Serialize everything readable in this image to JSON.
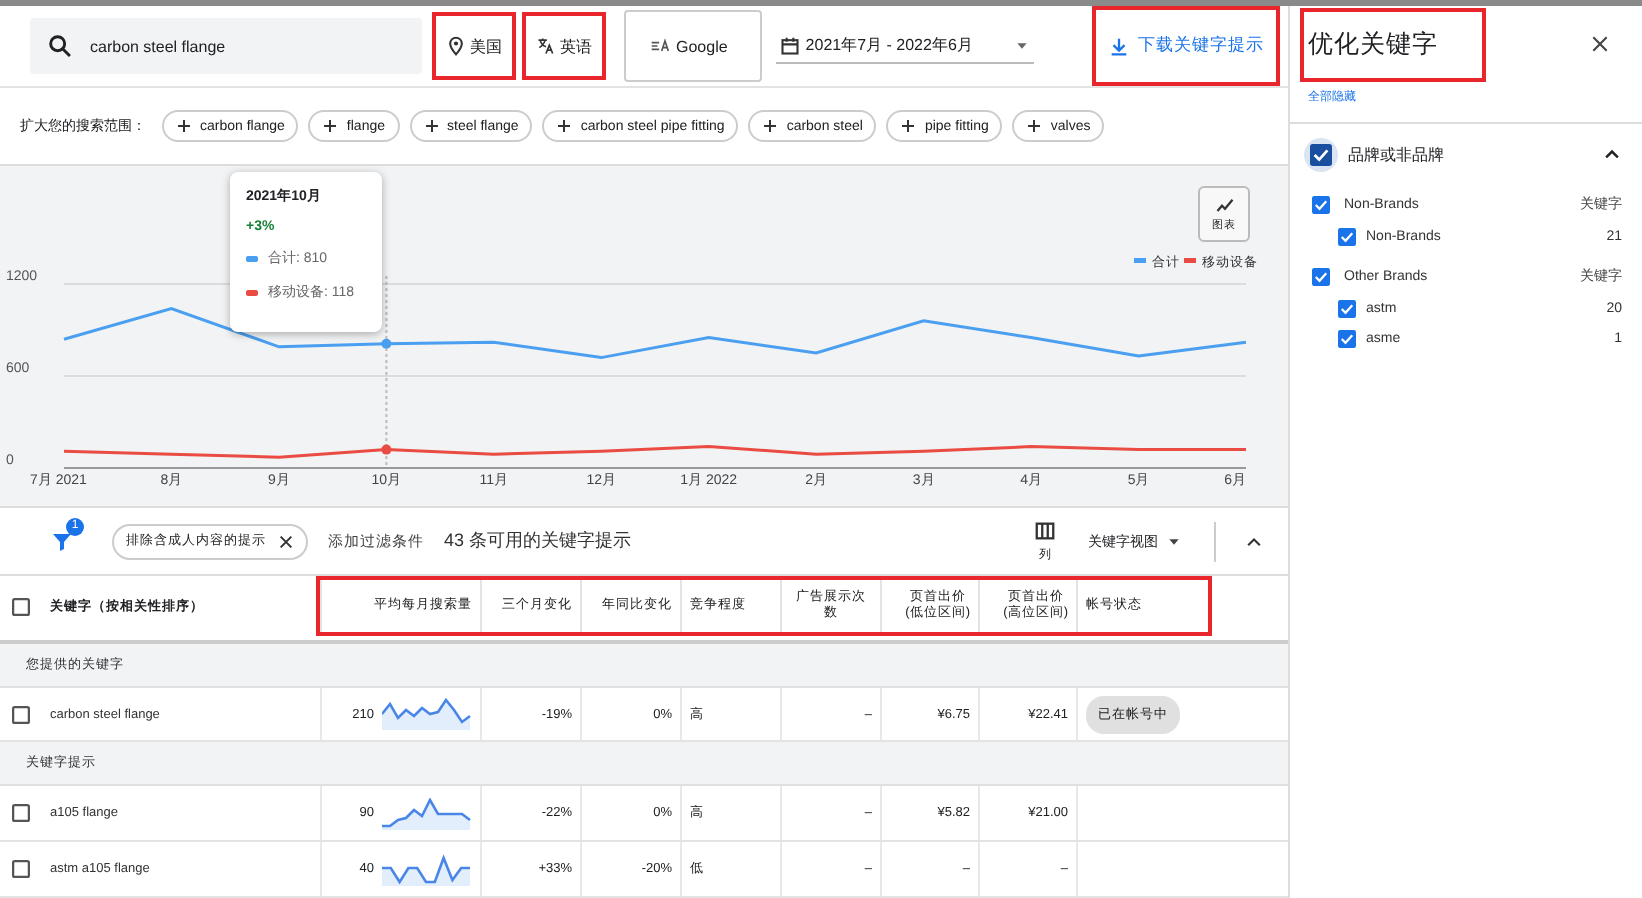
{
  "search": {
    "value": "carbon steel flange"
  },
  "location": {
    "label": "美国",
    "highlighted": true
  },
  "language": {
    "label": "英语",
    "highlighted": true
  },
  "network": {
    "label": "Google"
  },
  "date_range": {
    "label": "2021年7月 - 2022年6月"
  },
  "download_button": {
    "label": "下载关键字提示",
    "highlighted": true
  },
  "broaden": {
    "label": "扩大您的搜索范围：",
    "chips": [
      "carbon flange",
      "flange",
      "steel flange",
      "carbon steel pipe fitting",
      "carbon steel",
      "pipe fitting",
      "valves"
    ]
  },
  "chart": {
    "toggle_label": "图表",
    "tooltip": {
      "title": "2021年10月",
      "change": "+3%",
      "lines": [
        "合计: 810",
        "移动设备: 118"
      ]
    },
    "chart_data": {
      "type": "line",
      "categories": [
        "7月 2021",
        "8月",
        "9月",
        "10月",
        "11月",
        "12月",
        "1月 2022",
        "2月",
        "3月",
        "4月",
        "5月",
        "6月"
      ],
      "series": [
        {
          "name": "合计",
          "color": "#4a9ff0",
          "values": [
            840,
            1040,
            790,
            810,
            820,
            720,
            850,
            750,
            960,
            850,
            730,
            820
          ]
        },
        {
          "name": "移动设备",
          "color": "#ea4c43",
          "values": [
            110,
            90,
            70,
            120,
            90,
            110,
            140,
            90,
            110,
            140,
            120,
            120
          ]
        }
      ],
      "ylim": [
        0,
        1200
      ],
      "yticks": [
        0,
        600,
        1200
      ],
      "legend": "upper right",
      "ref_lines": [
        {
          "axis": "y",
          "value": 600
        },
        {
          "axis": "y",
          "value": 1200
        },
        {
          "axis": "x",
          "value": "10月"
        }
      ]
    }
  },
  "filter_bar": {
    "filter_count": "1",
    "chip": "排除含成人内容的提示",
    "add_filter": "添加过滤条件",
    "summary": "43 条可用的关键字提示",
    "columns_label": "列",
    "view_label": "关键字视图"
  },
  "table": {
    "header_highlighted": true,
    "all_checked": false,
    "columns": [
      "关键字（按相关性排序）",
      "平均每月搜索量",
      "三个月变化",
      "年同比变化",
      "竞争程度",
      "广告展示次数",
      "页首出价\n(低位区间)",
      "页首出价\n(高位区间)",
      "帐号状态"
    ],
    "sections": [
      {
        "title": "您提供的关键字",
        "rows": [
          {
            "checked": false,
            "keyword": "carbon steel flange",
            "volume": "210",
            "three_month": "-19%",
            "yoy": "0%",
            "competition": "高",
            "impressions": "–",
            "low_bid": "¥6.75",
            "high_bid": "¥22.41",
            "status": "已在帐号中"
          }
        ]
      },
      {
        "title": "关键字提示",
        "rows": [
          {
            "checked": false,
            "keyword": "a105 flange",
            "volume": "90",
            "three_month": "-22%",
            "yoy": "0%",
            "competition": "高",
            "impressions": "–",
            "low_bid": "¥5.82",
            "high_bid": "¥21.00"
          },
          {
            "checked": false,
            "keyword": "astm a105 flange",
            "volume": "40",
            "three_month": "+33%",
            "yoy": "-20%",
            "competition": "低",
            "impressions": "–",
            "low_bid": "–",
            "high_bid": "–"
          }
        ]
      }
    ]
  },
  "panel": {
    "title": "优化关键字",
    "title_highlighted": true,
    "hide_all": "全部隐藏",
    "groups": [
      {
        "label": "品牌或非品牌",
        "checked": true,
        "expanded": true,
        "children": [
          {
            "label": "Non-Brands",
            "checked": true,
            "column_label": "关键字",
            "children": [
              {
                "label": "Non-Brands",
                "checked": true,
                "count": "21"
              }
            ]
          },
          {
            "label": "Other Brands",
            "checked": true,
            "column_label": "关键字",
            "children": [
              {
                "label": "astm",
                "checked": true,
                "count": "20"
              },
              {
                "label": "asme",
                "checked": true,
                "count": "1"
              }
            ]
          }
        ]
      }
    ]
  }
}
